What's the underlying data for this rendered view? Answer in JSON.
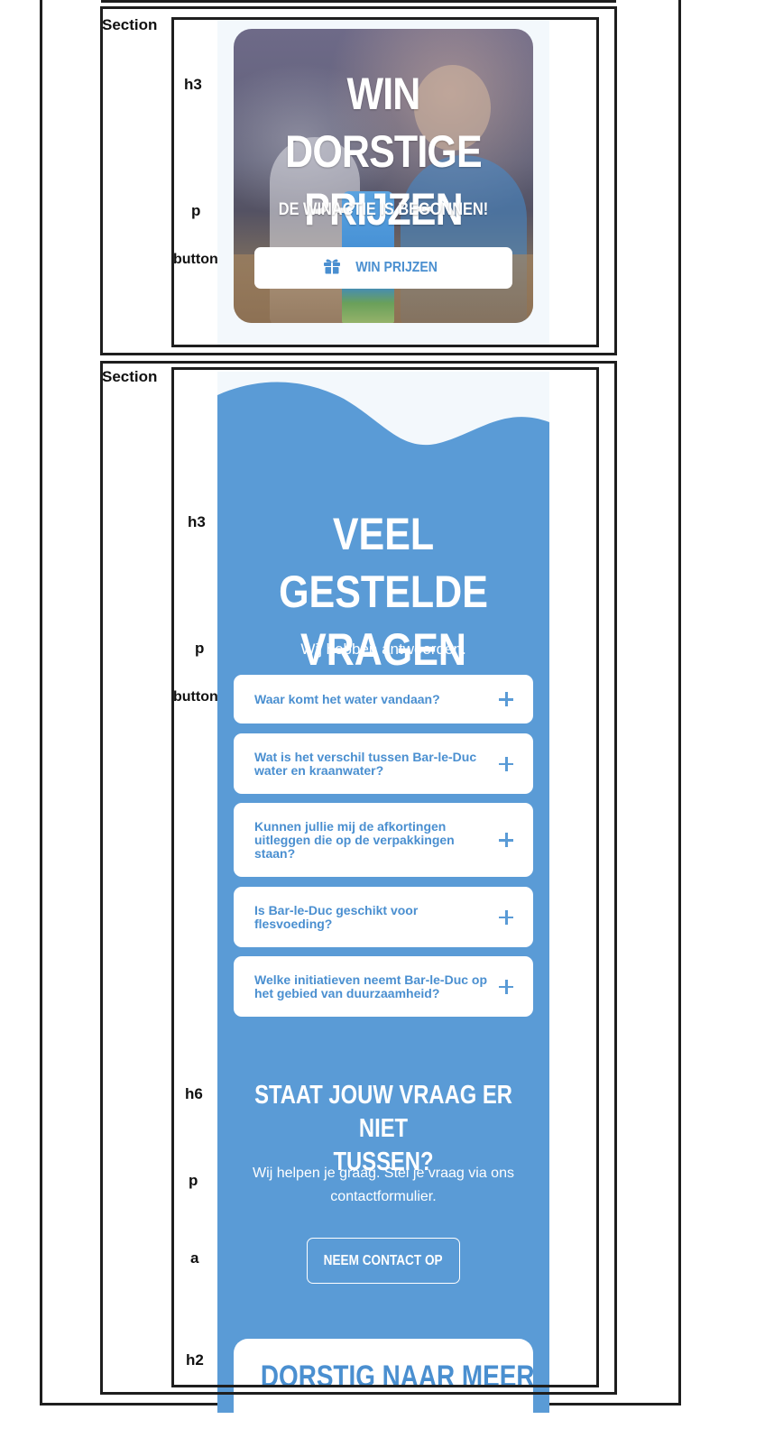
{
  "promo": {
    "section_tag": "Section",
    "tags": {
      "heading": "h3",
      "paragraph": "p",
      "button": "button"
    },
    "title_line1": "WIN DORSTIGE",
    "title_line2": "PRIJZEN",
    "subtitle": "DE WINACTIE IS BEGONNEN!",
    "button_label": "WIN PRIJZEN",
    "button_icon": "gift-icon"
  },
  "faq": {
    "section_tag": "Section",
    "tags": {
      "heading": "h3",
      "paragraph": "p",
      "button": "button",
      "help_heading": "h6",
      "help_paragraph": "p",
      "link": "a",
      "more_heading": "h2"
    },
    "title_line1": "VEEL GESTELDE",
    "title_line2": "VRAGEN",
    "subtitle": "Wij hebben antwoorden.",
    "questions": [
      "Waar komt het water vandaan?",
      "Wat is het verschil tussen Bar-le-Duc water en kraanwater?",
      "Kunnen jullie mij de afkortingen uitleggen die op de verpakkingen staan?",
      "Is Bar-le-Duc geschikt voor flesvoeding?",
      "Welke initiatieven neemt Bar-le-Duc op het gebied van duurzaamheid?"
    ],
    "expand_icon": "plus-icon",
    "help_title_line1": "STAAT JOUW VRAAG ER NIET",
    "help_title_line2": "TUSSEN?",
    "help_text": "Wij helpen je graag. Stel je vraag via ons contactformulier.",
    "contact_label": "NEEM CONTACT OP",
    "more_title": "DORSTIG NAAR MEER"
  },
  "colors": {
    "brand_blue": "#5a9bd6",
    "text_blue": "#4a8fd0",
    "outline": "#1e1e1e",
    "strip_bg": "#f3f8fc"
  }
}
